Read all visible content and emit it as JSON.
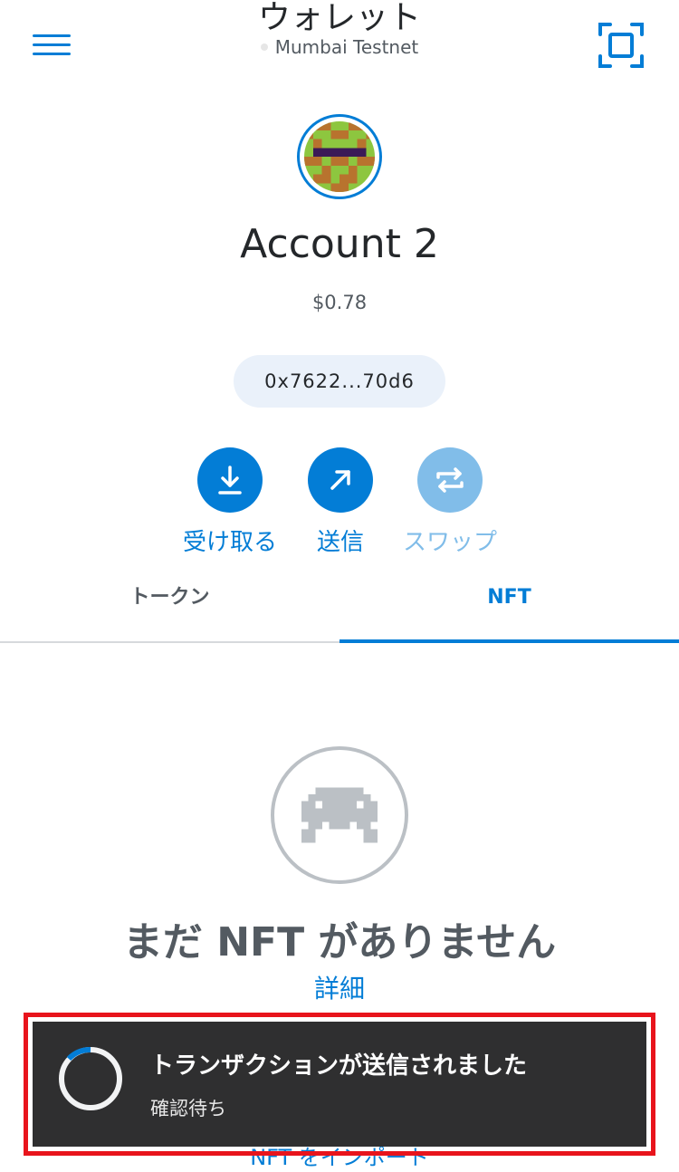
{
  "header": {
    "title": "ウォレット",
    "network": "Mumbai Testnet",
    "menu_icon": "hamburger-menu-icon",
    "scan_icon": "qr-scan-icon"
  },
  "account": {
    "name": "Account 2",
    "balance": "$0.78",
    "address": "0x7622...70d6"
  },
  "actions": [
    {
      "label": "受け取る",
      "icon": "download-icon",
      "enabled": true
    },
    {
      "label": "送信",
      "icon": "arrow-up-right-icon",
      "enabled": true
    },
    {
      "label": "スワップ",
      "icon": "swap-icon",
      "enabled": false
    }
  ],
  "tabs": [
    {
      "label": "トークン",
      "active": false
    },
    {
      "label": "NFT",
      "active": true
    }
  ],
  "empty_state": {
    "icon": "space-invader-icon",
    "title": "まだ NFT がありません",
    "details_link": "詳細",
    "import_link": "NFT をインポート"
  },
  "toast": {
    "title": "トランザクションが送信されました",
    "subtitle": "確認待ち"
  },
  "colors": {
    "accent": "#037dd6",
    "accent_disabled": "#81bde9",
    "toast_bg": "#2f2f30",
    "highlight_border": "#e8141c"
  }
}
